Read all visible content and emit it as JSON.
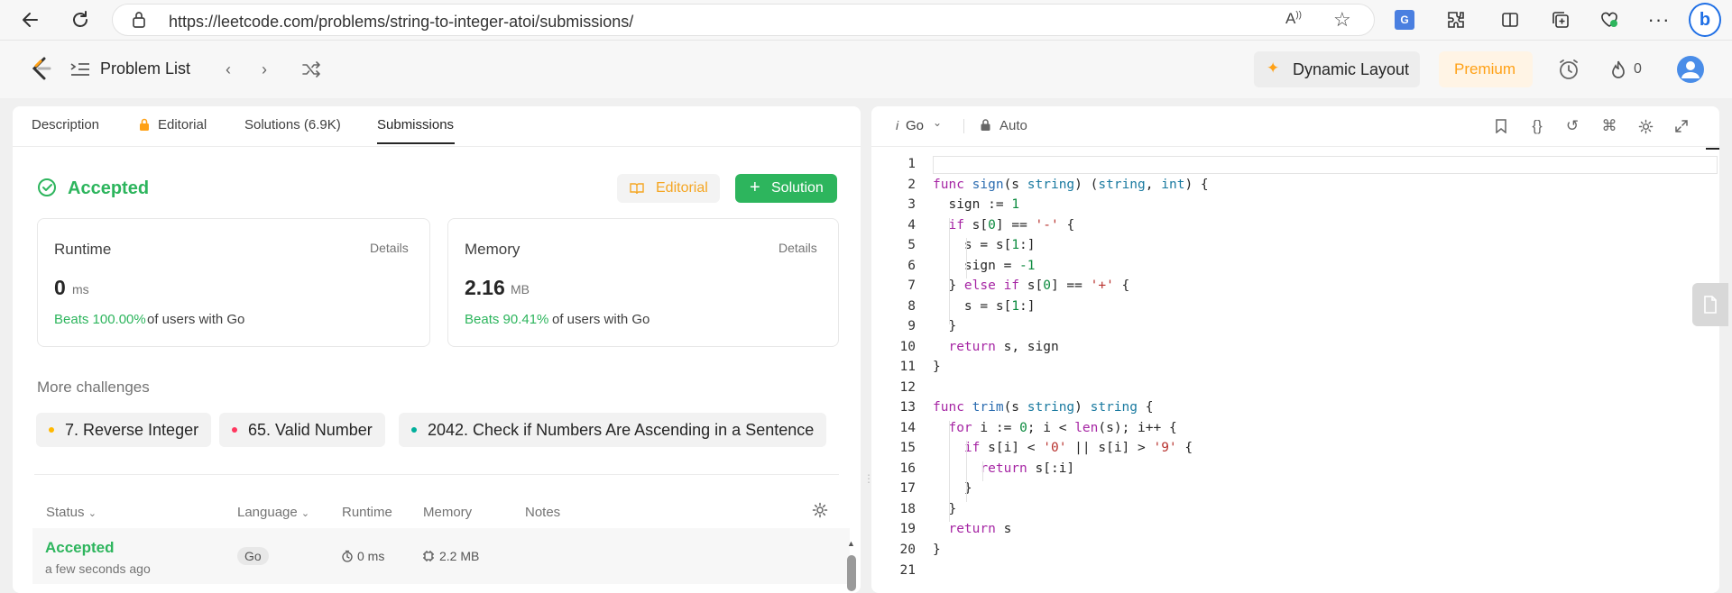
{
  "browser": {
    "url": "https://leetcode.com/problems/string-to-integer-atoi/submissions/"
  },
  "nav": {
    "problem_list": "Problem List",
    "dynamic_layout": "Dynamic Layout",
    "premium": "Premium",
    "streak_count": "0"
  },
  "tabs": [
    {
      "label": "Description"
    },
    {
      "label": "Editorial"
    },
    {
      "label": "Solutions (6.9K)"
    },
    {
      "label": "Submissions"
    }
  ],
  "result": {
    "status": "Accepted",
    "editorial_btn": "Editorial",
    "solution_btn": "Solution"
  },
  "runtime": {
    "title": "Runtime",
    "details": "Details",
    "value": "0",
    "unit": "ms",
    "beats": "Beats 100.00%",
    "suffix": "of users with Go"
  },
  "memory": {
    "title": "Memory",
    "details": "Details",
    "value": "2.16",
    "unit": "MB",
    "beats": "Beats 90.41%",
    "suffix": "of users with Go"
  },
  "challenges": {
    "heading": "More challenges",
    "items": [
      {
        "label": "7. Reverse Integer",
        "color": "#ffb800"
      },
      {
        "label": "65. Valid Number",
        "color": "#ff375f"
      },
      {
        "label": "2042. Check if Numbers Are Ascending in a Sentence",
        "color": "#00af9b"
      }
    ]
  },
  "table": {
    "headers": [
      "Status",
      "Language",
      "Runtime",
      "Memory",
      "Notes"
    ],
    "row": {
      "status": "Accepted",
      "time": "a few seconds ago",
      "language": "Go",
      "runtime": "0 ms",
      "memory": "2.2 MB"
    }
  },
  "editor": {
    "language": "Go",
    "mode": "Auto"
  },
  "colors": {
    "accepted": "#2db55d",
    "editorial": "#f5a623",
    "premium_bg": "#fff4e5",
    "premium_text": "#ffa116"
  },
  "code_lines": [
    "1",
    "2",
    "3",
    "4",
    "5",
    "6",
    "7",
    "8",
    "9",
    "10",
    "11",
    "12",
    "13",
    "14",
    "15",
    "16",
    "17",
    "18",
    "19",
    "20",
    "21"
  ]
}
